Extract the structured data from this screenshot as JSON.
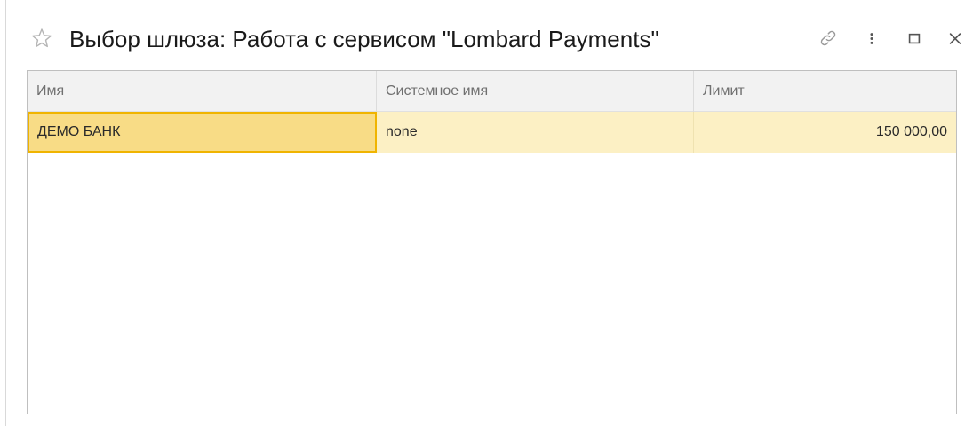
{
  "window": {
    "title": "Выбор шлюза: Работа с сервисом \"Lombard Payments\"",
    "icons": {
      "favorite": "star-outline-icon",
      "link": "link-icon",
      "more": "more-vertical-icon",
      "maximize": "maximize-icon",
      "close": "close-icon"
    }
  },
  "table": {
    "columns": [
      "Имя",
      "Системное имя",
      "Лимит"
    ],
    "rows": [
      {
        "name": "ДЕМО БАНК",
        "system_name": "none",
        "limit": "150 000,00",
        "selected": true
      }
    ]
  },
  "colors": {
    "selected_row": "#fcf0c4",
    "selected_cell": "#f8dc86",
    "selected_cell_border": "#f0b400",
    "header_bg": "#f2f2f2"
  }
}
